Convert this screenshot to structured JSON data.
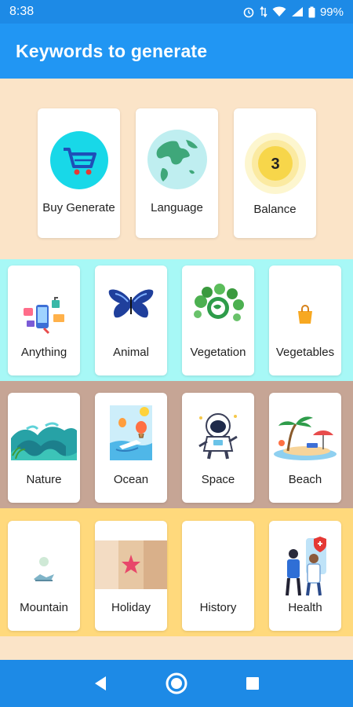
{
  "status_bar": {
    "time": "8:38",
    "battery": "99%"
  },
  "app_bar": {
    "title": "Keywords to generate"
  },
  "balance_value": "3",
  "top_cards": [
    {
      "label": "Buy Generate",
      "icon": "cart-icon"
    },
    {
      "label": "Language",
      "icon": "globe-icon"
    },
    {
      "label": "Balance",
      "icon": "coin-icon"
    }
  ],
  "row2": [
    {
      "label": "Anything",
      "icon": "media-icon"
    },
    {
      "label": "Animal",
      "icon": "butterfly-icon"
    },
    {
      "label": "Vegetation",
      "icon": "leafy-earth-icon"
    },
    {
      "label": "Vegetables",
      "icon": "shopping-bag-icon"
    }
  ],
  "row3": [
    {
      "label": "Nature",
      "icon": "waves-landscape-icon"
    },
    {
      "label": "Ocean",
      "icon": "ship-balloon-icon"
    },
    {
      "label": "Space",
      "icon": "astronaut-icon"
    },
    {
      "label": "Beach",
      "icon": "palm-beach-icon"
    }
  ],
  "row4": [
    {
      "label": "Mountain",
      "icon": "mountain-icon"
    },
    {
      "label": "Holiday",
      "icon": "starfish-icon"
    },
    {
      "label": "History",
      "icon": ""
    },
    {
      "label": "Health",
      "icon": "doctors-icon"
    }
  ],
  "colors": {
    "status_bar": "#1d8ae6",
    "app_bar": "#2196f3",
    "band_peach": "#fbe4c8",
    "band_cyan": "#a7f8f6",
    "band_brown": "#c6a595",
    "band_yellow": "#ffd97c"
  }
}
